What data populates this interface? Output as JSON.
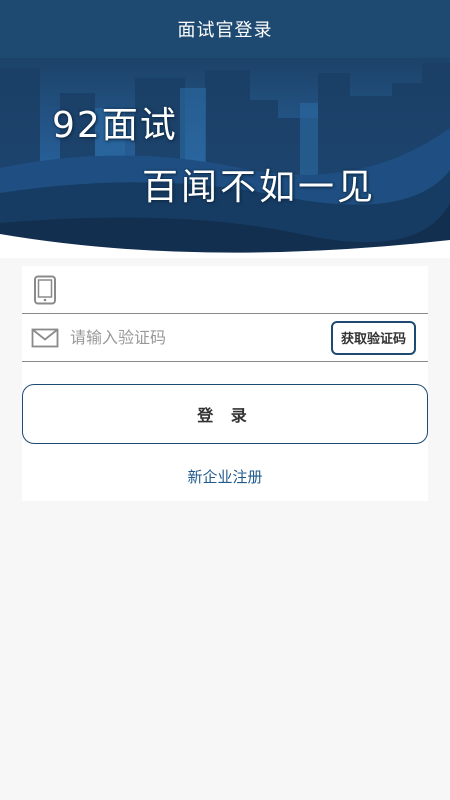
{
  "header": {
    "title": "面试官登录"
  },
  "banner": {
    "line1": "92面试",
    "line2": "百闻不如一见"
  },
  "form": {
    "phone": {
      "value": "",
      "placeholder": "",
      "icon": "tablet-icon"
    },
    "code": {
      "value": "",
      "placeholder": "请输入验证码",
      "icon": "envelope-icon"
    },
    "get_code_label": "获取验证码",
    "login_label": "登 录",
    "register_label": "新企业注册"
  },
  "colors": {
    "header_bg": "#1e4a72",
    "accent": "#1e4a72",
    "link": "#1e5a8c",
    "background": "#f7f7f7"
  }
}
